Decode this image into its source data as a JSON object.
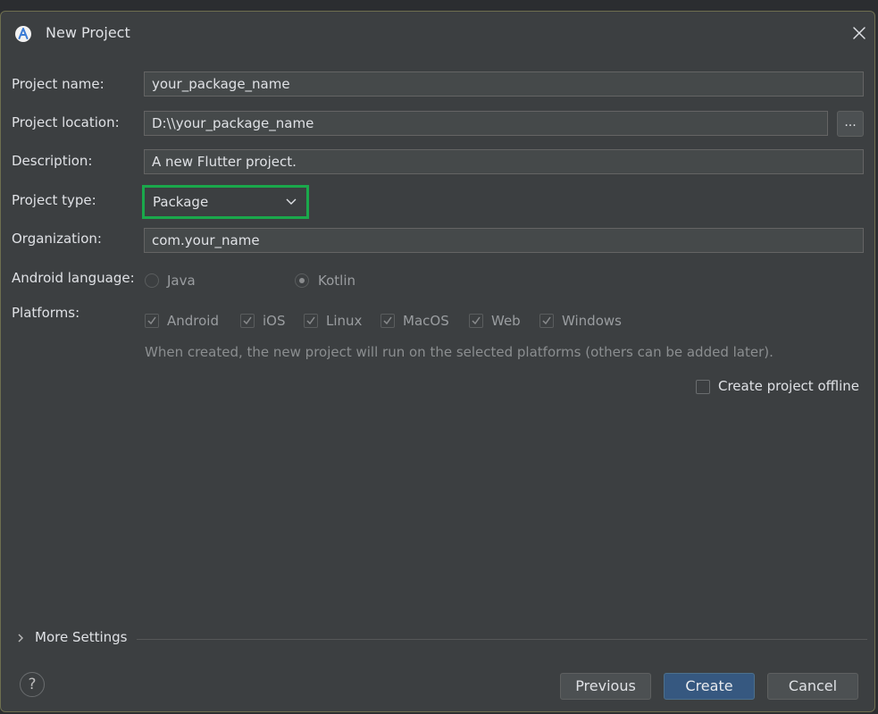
{
  "dialog": {
    "title": "New Project"
  },
  "form": {
    "project_name": {
      "label": "Project name:",
      "value": "your_package_name"
    },
    "project_location": {
      "label": "Project location:",
      "value": "D:\\\\your_package_name",
      "browse_label": "..."
    },
    "description": {
      "label": "Description:",
      "value": "A new Flutter project."
    },
    "project_type": {
      "label": "Project type:",
      "value": "Package"
    },
    "organization": {
      "label": "Organization:",
      "value": "com.your_name"
    },
    "android_language": {
      "label": "Android language:",
      "options": [
        {
          "label": "Java",
          "checked": false
        },
        {
          "label": "Kotlin",
          "checked": true
        }
      ]
    },
    "platforms": {
      "label": "Platforms:",
      "options": [
        {
          "label": "Android",
          "checked": true
        },
        {
          "label": "iOS",
          "checked": true
        },
        {
          "label": "Linux",
          "checked": true
        },
        {
          "label": "MacOS",
          "checked": true
        },
        {
          "label": "Web",
          "checked": true
        },
        {
          "label": "Windows",
          "checked": true
        }
      ],
      "hint": "When created, the new project will run on the selected platforms (others can be added later)."
    },
    "create_offline": {
      "label": "Create project offline",
      "checked": false
    }
  },
  "more_settings": {
    "label": "More Settings"
  },
  "footer": {
    "help": "?",
    "previous": "Previous",
    "create": "Create",
    "cancel": "Cancel"
  },
  "colors": {
    "highlight": "#1aa84b",
    "primary_button": "#365880"
  }
}
